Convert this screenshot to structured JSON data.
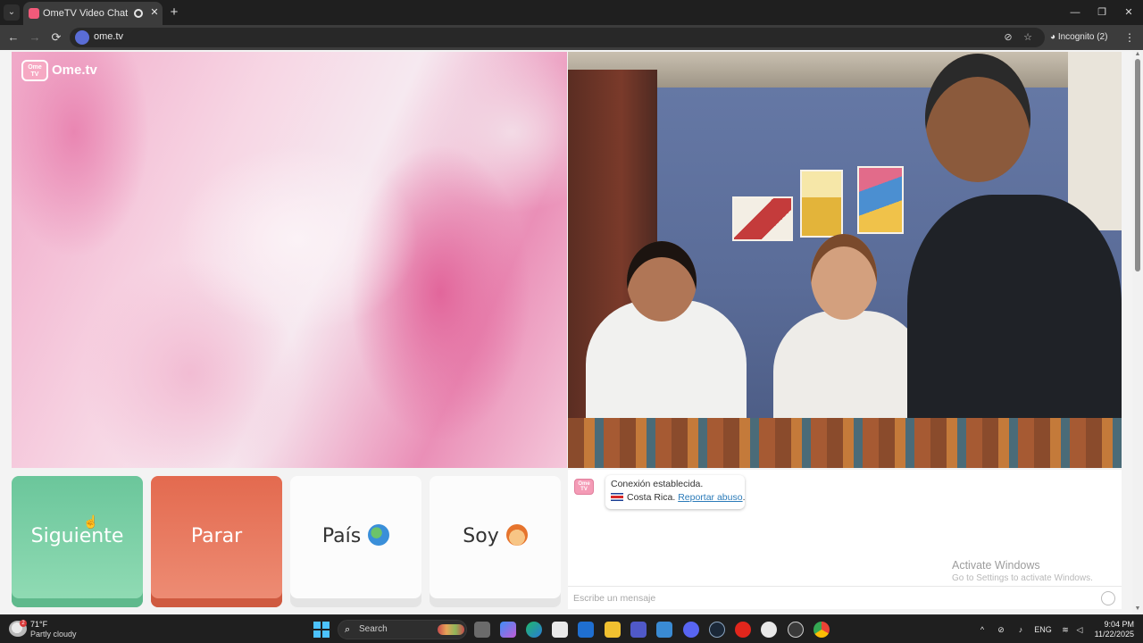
{
  "browser": {
    "tab_title": "OmeTV Video Chat — Ome",
    "tab_close_glyph": "✕",
    "new_tab_glyph": "+",
    "tab_menu_glyph": "⌄",
    "url": "ome.tv",
    "incognito_label": "Incognito (2)",
    "back_glyph": "←",
    "forward_glyph": "→",
    "reload_glyph": "⟳",
    "minimize_glyph": "—",
    "restore_glyph": "❐",
    "close_glyph": "✕",
    "eye_off_glyph": "⊘",
    "star_glyph": "☆",
    "kebab_glyph": "⋮",
    "incognito_glyph": "◕",
    "icons": [
      "tab-menu-icon",
      "favicon-icon",
      "recording-icon",
      "close-icon",
      "plus-icon",
      "back-icon",
      "forward-icon",
      "reload-icon",
      "site-info-icon",
      "eye-off-icon",
      "star-icon",
      "incognito-icon",
      "kebab-menu-icon"
    ]
  },
  "site": {
    "logo_text": "Ome.tv",
    "logo_badge_text": "Ome TV"
  },
  "controls": {
    "next_label": "Siguiente",
    "stop_label": "Parar",
    "country_label": "País",
    "gender_label": "Soy",
    "colors": {
      "next": "#6bc69b",
      "stop": "#e36a4f",
      "neutral": "#fcfcfc"
    }
  },
  "chat": {
    "avatar_text": "Ome TV",
    "system_line1": "Conexión establecida.",
    "country": "Costa Rica.",
    "report_link": "Reportar abuso",
    "report_suffix": ".",
    "input_placeholder": "Escribe un mensaje",
    "link_color": "#2b7bb9"
  },
  "watermark": {
    "title": "Activate Windows",
    "subtitle": "Go to Settings to activate Windows."
  },
  "taskbar": {
    "weather_temp": "71°F",
    "weather_desc": "Partly cloudy",
    "weather_badge": "2",
    "search_label": "Search",
    "search_glyph": "⌕",
    "tray_chevron": "^",
    "language": "ENG",
    "time": "9:04 PM",
    "date": "11/22/2025",
    "accent": "#4cc2ff",
    "pinned_apps": [
      "file-icon",
      "copilot-icon",
      "edge-icon",
      "store-icon",
      "outlook-icon",
      "folder-icon",
      "teams-icon",
      "photos-icon",
      "discord-icon",
      "steam-icon",
      "opera-icon",
      "obs-icon",
      "chatgpt-icon",
      "chrome-icon"
    ]
  }
}
